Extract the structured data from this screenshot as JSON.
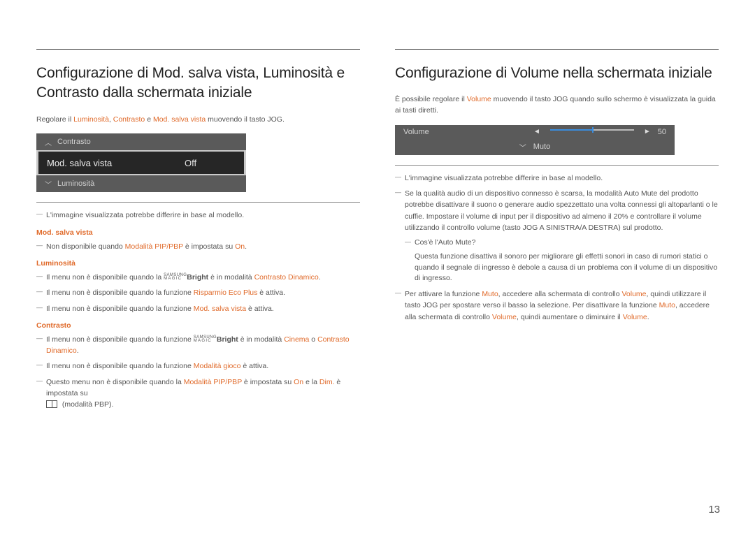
{
  "page_number": "13",
  "left": {
    "heading": "Configurazione di Mod. salva vista, Luminosità e Contrasto dalla schermata iniziale",
    "intro_1": "Regolare il ",
    "intro_lum": "Luminosità",
    "intro_2": ", ",
    "intro_con": "Contrasto",
    "intro_3": " e ",
    "intro_msv": "Mod. salva vista",
    "intro_4": " muovendo il tasto JOG.",
    "osd": {
      "row_top": "Contrasto",
      "row_mid_label": "Mod. salva vista",
      "row_mid_value": "Off",
      "row_bot": "Luminosità"
    },
    "note_differ": "L'immagine visualizzata potrebbe differire in base al modello.",
    "sh_msv": "Mod. salva vista",
    "msv_note_pre": "Non disponibile quando ",
    "msv_note_mode": "Modalità PIP/PBP",
    "msv_note_mid": " è impostata su ",
    "msv_note_on": "On",
    "msv_note_post": ".",
    "sh_lum": "Luminosità",
    "lum_n1_pre": "Il menu non è disponibile quando la ",
    "lum_n1_bright": "Bright",
    "lum_n1_mid": " è in modalità ",
    "lum_n1_cd": "Contrasto Dinamico",
    "lum_n1_post": ".",
    "lum_n2_pre": "Il menu non è disponibile quando la funzione ",
    "lum_n2_eco": "Risparmio Eco Plus",
    "lum_n2_post": " è attiva.",
    "lum_n3_pre": "Il menu non è disponibile quando la funzione ",
    "lum_n3_msv": "Mod. salva vista",
    "lum_n3_post": " è attiva.",
    "sh_con": "Contrasto",
    "con_n1_pre": "Il menu non è disponibile quando la funzione ",
    "con_n1_bright": "Bright",
    "con_n1_mid": " è in modalità ",
    "con_n1_cin": "Cinema",
    "con_n1_o": " o ",
    "con_n1_cd": "Contrasto Dinamico",
    "con_n1_post": ".",
    "con_n2_pre": "Il menu non è disponibile quando la funzione ",
    "con_n2_gm": "Modalità gioco",
    "con_n2_post": " è attiva.",
    "con_n3_pre": "Questo menu non è disponibile quando la ",
    "con_n3_mode": "Modalità PIP/PBP",
    "con_n3_mid": " è impostata su ",
    "con_n3_on": "On",
    "con_n3_and": " e la ",
    "con_n3_dim": "Dim.",
    "con_n3_post": " è impostata su",
    "con_n3_tail": " (modalità PBP).",
    "magic_top": "SAMSUNG",
    "magic_bot": "MAGIC"
  },
  "right": {
    "heading": "Configurazione di Volume nella schermata iniziale",
    "intro_1": "È possibile regolare il ",
    "intro_vol": "Volume",
    "intro_2": " muovendo il tasto JOG quando sullo schermo è visualizzata la guida ai tasti diretti.",
    "osd": {
      "label": "Volume",
      "value": "50",
      "muto": "Muto"
    },
    "note_differ": "L'immagine visualizzata potrebbe differire in base al modello.",
    "n2": "Se la qualità audio di un dispositivo connesso è scarsa, la modalità Auto Mute del prodotto potrebbe disattivare il suono o generare audio spezzettato una volta connessi gli altoparlanti o le cuffie. Impostare il volume di input per il dispositivo ad almeno il 20% e controllare il volume utilizzando il controllo volume (tasto JOG A SINISTRA/A DESTRA) sul prodotto.",
    "n2_q": "Cos'è l'Auto Mute?",
    "n2_a": "Questa funzione disattiva il sonoro per migliorare gli effetti sonori in caso di rumori statici o quando il segnale di ingresso è debole a causa di un problema con il volume di un dispositivo di ingresso.",
    "n3_pre": "Per attivare la funzione ",
    "n3_muto1": "Muto",
    "n3_mid1": ", accedere alla schermata di controllo ",
    "n3_vol1": "Volume",
    "n3_mid2": ", quindi utilizzare il tasto JOG per spostare verso il basso la selezione. Per disattivare la funzione ",
    "n3_muto2": "Muto",
    "n3_mid3": ", accedere alla schermata di controllo ",
    "n3_vol2": "Volume",
    "n3_mid4": ", quindi aumentare o diminuire il ",
    "n3_vol3": "Volume",
    "n3_post": "."
  }
}
